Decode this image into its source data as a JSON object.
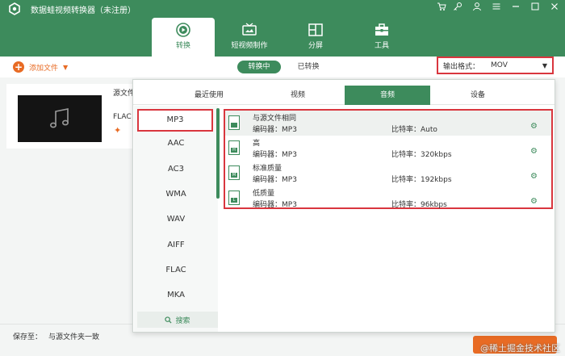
{
  "window": {
    "title": "数据蛙视频转换器（未注册）",
    "controls": [
      "cart-icon",
      "key-icon",
      "user-icon",
      "menu-icon",
      "minimize-icon",
      "close-icon"
    ]
  },
  "nav": {
    "tabs": [
      {
        "label": "转换",
        "icon": "convert-icon",
        "active": true
      },
      {
        "label": "短视频制作",
        "icon": "tv-icon",
        "active": false
      },
      {
        "label": "分屏",
        "icon": "split-icon",
        "active": false
      },
      {
        "label": "工具",
        "icon": "toolbox-icon",
        "active": false
      }
    ]
  },
  "toolbar": {
    "add_files": "添加文件",
    "converting": "转换中",
    "converted": "已转换",
    "output_format_label": "输出格式：",
    "output_format_value": "MOV"
  },
  "file": {
    "source_label": "源文件",
    "format": "FLAC"
  },
  "bottom": {
    "save_to_label": "保存至：",
    "save_to_value": "与源文件夹一致",
    "watermark": "@稀土掘金技术社区"
  },
  "panel": {
    "tabs": [
      {
        "label": "最近使用",
        "active": false
      },
      {
        "label": "视频",
        "active": false
      },
      {
        "label": "音频",
        "active": true
      },
      {
        "label": "设备",
        "active": false
      }
    ],
    "formats": [
      "MP3",
      "AAC",
      "AC3",
      "WMA",
      "WAV",
      "AIFF",
      "FLAC",
      "MKA"
    ],
    "selected_format": "MP3",
    "search_label": "搜索",
    "qualities": [
      {
        "name": "与源文件相同",
        "encoder": "编码器：MP3",
        "bitrate": "比特率：Auto",
        "badge": ""
      },
      {
        "name": "高",
        "encoder": "编码器：MP3",
        "bitrate": "比特率：320kbps",
        "badge": "H"
      },
      {
        "name": "标准质量",
        "encoder": "编码器：MP3",
        "bitrate": "比特率：192kbps",
        "badge": "M"
      },
      {
        "name": "低质量",
        "encoder": "编码器：MP3",
        "bitrate": "比特率：96kbps",
        "badge": "L"
      }
    ]
  },
  "colors": {
    "brand_green": "#3d8b5c",
    "accent_orange": "#e86b24",
    "highlight_red": "#d9363e"
  }
}
